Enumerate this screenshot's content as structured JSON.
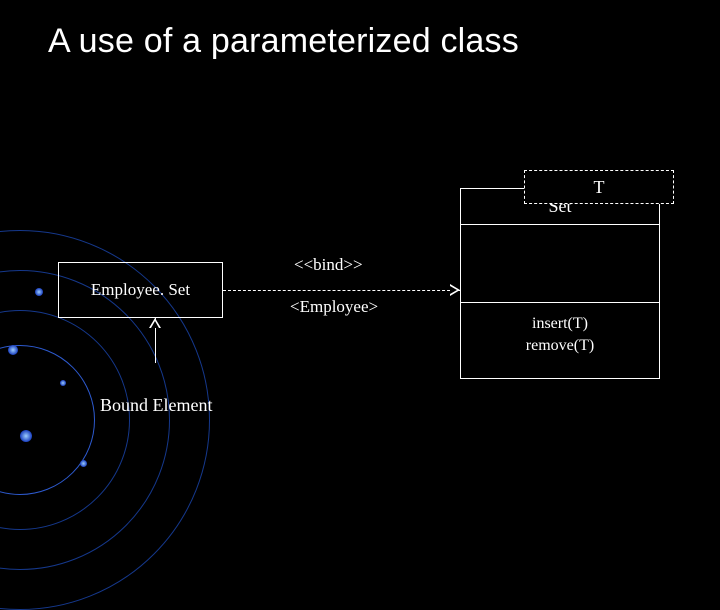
{
  "title": "A use of a parameterized class",
  "template_class": {
    "parameter": "T",
    "name": "Set",
    "operations": [
      "insert(T)",
      "remove(T)"
    ]
  },
  "bound_element": {
    "name": "Employee. Set"
  },
  "binding": {
    "stereotype": "<<bind>>",
    "argument": "<Employee>"
  },
  "annotation": {
    "bound_label": "Bound Element"
  }
}
